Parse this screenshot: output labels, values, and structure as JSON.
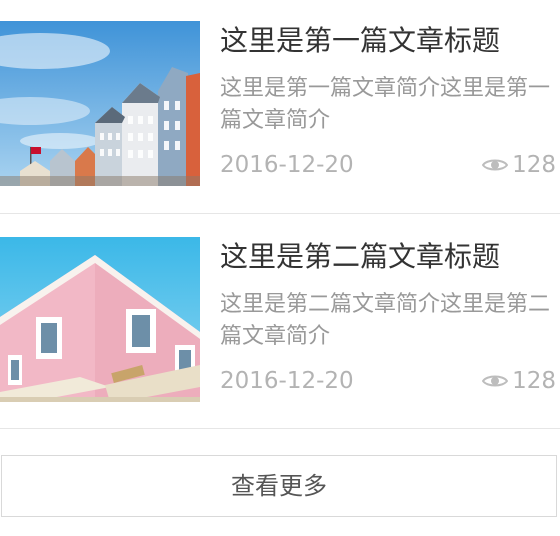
{
  "articles": [
    {
      "title": "这里是第一篇文章标题",
      "summary": "这里是第一篇文章简介这里是第一篇文章简介",
      "date": "2016-12-20",
      "views": "128",
      "image": "colorful-harbor-buildings-photo"
    },
    {
      "title": "这里是第二篇文章标题",
      "summary": "这里是第二篇文章简介这里是第二篇文章简介",
      "date": "2016-12-20",
      "views": "128",
      "image": "pink-building-photo"
    }
  ],
  "icons": {
    "views": "eye-icon"
  },
  "colors": {
    "title": "#333333",
    "summary": "#999999",
    "meta": "#b3b3b3",
    "divider": "#e6e6e6",
    "button_border": "#d9d9d9"
  },
  "load_more": {
    "label": "查看更多"
  }
}
